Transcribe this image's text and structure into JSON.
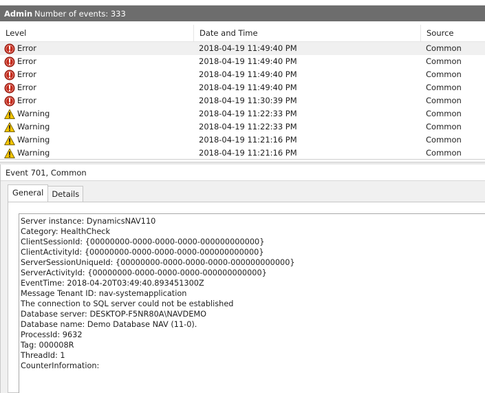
{
  "header": {
    "log_name": "Admin",
    "event_count": "Number of events: 333"
  },
  "columns": {
    "level": "Level",
    "date_time": "Date and Time",
    "source": "Source"
  },
  "events": [
    {
      "level": "Error",
      "icon": "error-icon",
      "date_time": "2018-04-19 11:49:40 PM",
      "source": "Common"
    },
    {
      "level": "Error",
      "icon": "error-icon",
      "date_time": "2018-04-19 11:49:40 PM",
      "source": "Common"
    },
    {
      "level": "Error",
      "icon": "error-icon",
      "date_time": "2018-04-19 11:49:40 PM",
      "source": "Common"
    },
    {
      "level": "Error",
      "icon": "error-icon",
      "date_time": "2018-04-19 11:49:40 PM",
      "source": "Common"
    },
    {
      "level": "Error",
      "icon": "error-icon",
      "date_time": "2018-04-19 11:30:39 PM",
      "source": "Common"
    },
    {
      "level": "Warning",
      "icon": "warning-icon",
      "date_time": "2018-04-19 11:22:33 PM",
      "source": "Common"
    },
    {
      "level": "Warning",
      "icon": "warning-icon",
      "date_time": "2018-04-19 11:22:33 PM",
      "source": "Common"
    },
    {
      "level": "Warning",
      "icon": "warning-icon",
      "date_time": "2018-04-19 11:21:16 PM",
      "source": "Common"
    },
    {
      "level": "Warning",
      "icon": "warning-icon",
      "date_time": "2018-04-19 11:21:16 PM",
      "source": "Common"
    }
  ],
  "detail": {
    "title": "Event 701, Common",
    "tabs": {
      "general": "General",
      "details": "Details"
    },
    "message_lines": [
      "Server instance: DynamicsNAV110",
      "Category: HealthCheck",
      "ClientSessionId: {00000000-0000-0000-0000-000000000000}",
      "ClientActivityId: {00000000-0000-0000-0000-000000000000}",
      "ServerSessionUniqueId: {00000000-0000-0000-0000-000000000000}",
      "ServerActivityId: {00000000-0000-0000-0000-000000000000}",
      "EventTime: 2018-04-20T03:49:40.893451300Z",
      "Message Tenant ID: nav-systemapplication",
      "The connection to SQL server could not be established",
      "Database server: DESKTOP-F5NR80A\\NAVDEMO",
      "Database name: Demo Database NAV (11-0).",
      "ProcessId: 9632",
      "Tag: 000008R",
      "ThreadId: 1",
      "CounterInformation:"
    ]
  },
  "colors": {
    "titlebar_bg": "#6d6d6d",
    "error_red": "#c42b1c",
    "warning_yellow": "#f5c400",
    "selected_row": "#f0f0f0"
  }
}
